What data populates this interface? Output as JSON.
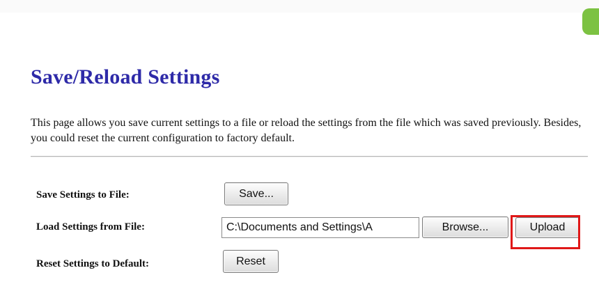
{
  "page": {
    "title": "Save/Reload Settings",
    "description": "This page allows you save current settings to a file or reload the settings from the file which was saved previously. Besides, you could reset the current configuration to factory default."
  },
  "rows": {
    "save": {
      "label": "Save Settings to File:",
      "button": "Save..."
    },
    "load": {
      "label": "Load Settings from File:",
      "file_value": "C:\\Documents and Settings\\A",
      "browse_button": "Browse...",
      "upload_button": "Upload"
    },
    "reset": {
      "label": "Reset Settings to Default:",
      "button": "Reset"
    }
  },
  "colors": {
    "title": "#2e2aa8",
    "highlight": "#e01818",
    "side_tab": "#7cc242"
  }
}
